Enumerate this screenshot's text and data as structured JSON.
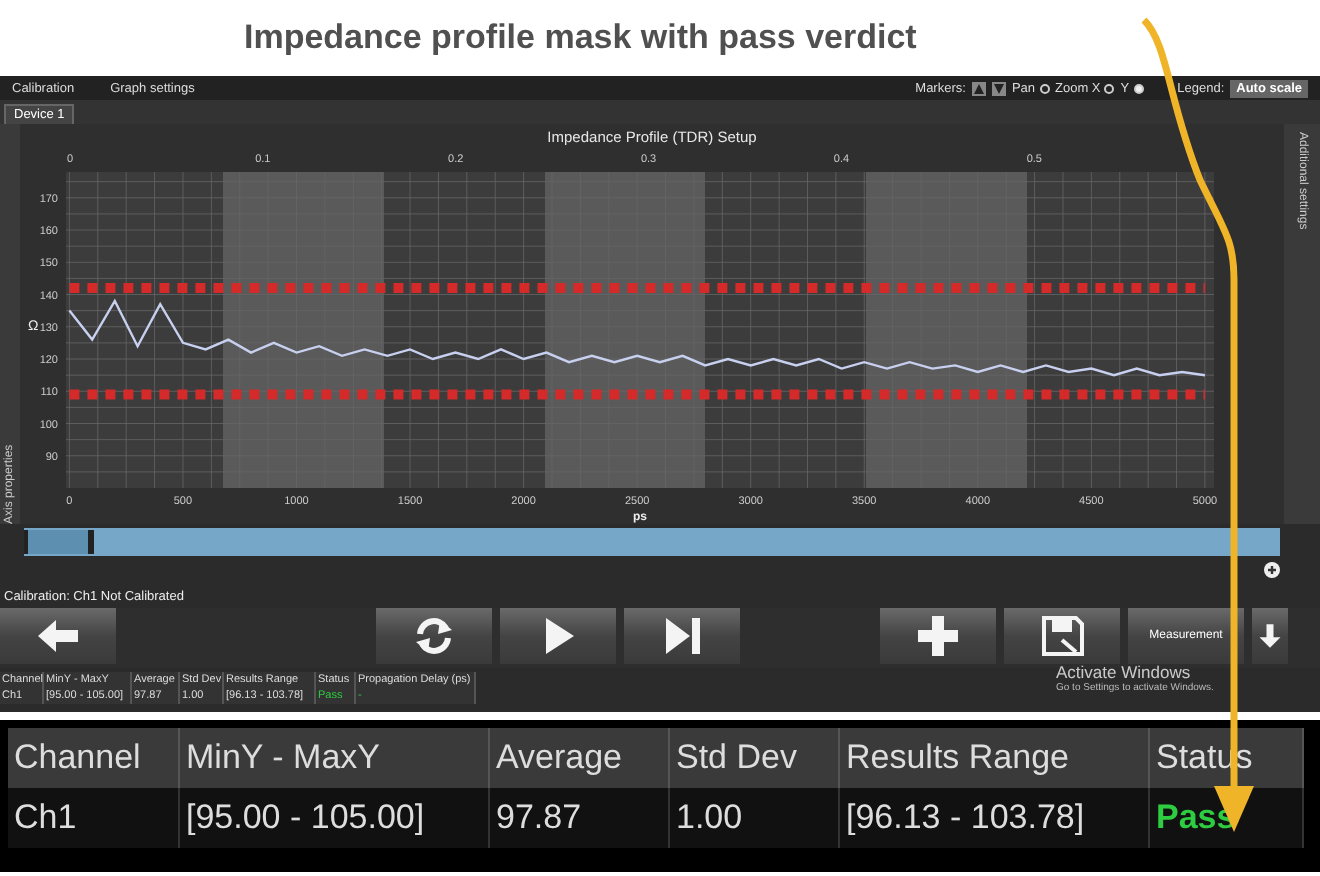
{
  "caption": "Impedance profile mask with pass verdict",
  "menu": [
    {
      "label": "Calibration"
    },
    {
      "label": "Graph settings"
    }
  ],
  "toolbar": {
    "markers_label": "Markers:",
    "modes": [
      {
        "label": "Pan",
        "selected": false
      },
      {
        "label": "Zoom X",
        "selected": false
      },
      {
        "label": "Y",
        "selected": true
      }
    ],
    "legend_label": "Legend:",
    "auto_scale": "Auto scale"
  },
  "tab": {
    "label": "Device 1",
    "selected": true
  },
  "side_panels": {
    "left": "Axis properties",
    "right": "Additional settings"
  },
  "chart": {
    "top_axis_ticks": [
      "0",
      "0.1",
      "0.2",
      "0.3",
      "0.4",
      "0.5"
    ],
    "chart_data": {
      "type": "line",
      "grid": true,
      "title": "Impedance Profile (TDR) Setup",
      "xlabel": "ps",
      "ylabel": "Ω",
      "xlim": [
        -15,
        5040
      ],
      "ylim": [
        80,
        178
      ],
      "xticks": [
        0,
        500,
        1000,
        1500,
        2000,
        2500,
        3000,
        3500,
        4000,
        4500,
        5000
      ],
      "yticks": [
        90,
        100,
        110,
        120,
        130,
        140,
        150,
        160,
        170
      ],
      "x": [
        0,
        100,
        200,
        300,
        400,
        500,
        600,
        700,
        800,
        900,
        1000,
        1100,
        1200,
        1300,
        1400,
        1500,
        1600,
        1700,
        1800,
        1900,
        2000,
        2100,
        2200,
        2300,
        2400,
        2500,
        2600,
        2700,
        2800,
        2900,
        3000,
        3100,
        3200,
        3300,
        3400,
        3500,
        3600,
        3700,
        3800,
        3900,
        4000,
        4100,
        4200,
        4300,
        4400,
        4500,
        4600,
        4700,
        4800,
        4900,
        5000
      ],
      "series": [
        {
          "color": "#c8d0f0",
          "line_style": "solid",
          "values": [
            135,
            126,
            138,
            124,
            137,
            125,
            123,
            126,
            122,
            125,
            122,
            124,
            121,
            123,
            121,
            123,
            120,
            122,
            120,
            123,
            120,
            122,
            119,
            121,
            119,
            121,
            119,
            121,
            118,
            120,
            118,
            120,
            118,
            120,
            117,
            119,
            117,
            119,
            117,
            118,
            116,
            118,
            116,
            118,
            116,
            117,
            115,
            117,
            115,
            116,
            115
          ]
        },
        {
          "color": "#d42a2a",
          "line_style": "dashed",
          "values": [
            142,
            142,
            142,
            142,
            142,
            142,
            142,
            142,
            142,
            142,
            142,
            142,
            142,
            142,
            142,
            142,
            142,
            142,
            142,
            142,
            142,
            142,
            142,
            142,
            142,
            142,
            142,
            142,
            142,
            142,
            142,
            142,
            142,
            142,
            142,
            142,
            142,
            142,
            142,
            142,
            142,
            142,
            142,
            142,
            142,
            142,
            142,
            142,
            142,
            142,
            142
          ]
        },
        {
          "color": "#d42a2a",
          "line_style": "dashed",
          "values": [
            109,
            109,
            109,
            109,
            109,
            109,
            109,
            109,
            109,
            109,
            109,
            109,
            109,
            109,
            109,
            109,
            109,
            109,
            109,
            109,
            109,
            109,
            109,
            109,
            109,
            109,
            109,
            109,
            109,
            109,
            109,
            109,
            109,
            109,
            109,
            109,
            109,
            109,
            109,
            109,
            109,
            109,
            109,
            109,
            109,
            109,
            109,
            109,
            109,
            109,
            109
          ]
        }
      ]
    }
  },
  "status_text": "Calibration: Ch1 Not Calibrated",
  "button_groups": [
    [
      {
        "kind": "back"
      }
    ],
    [
      {
        "kind": "refresh"
      },
      {
        "kind": "play"
      },
      {
        "kind": "step"
      }
    ],
    [
      {
        "kind": "add"
      },
      {
        "kind": "save"
      },
      {
        "kind": "measurement",
        "label": "Measurement"
      },
      {
        "kind": "down"
      }
    ]
  ],
  "activation_notice": {
    "title": "Activate Windows",
    "subtitle": "Go to Settings to activate Windows."
  },
  "results_table": {
    "columns": [
      "Channel",
      "MinY - MaxY",
      "Average",
      "Std Dev",
      "Results Range",
      "Status",
      "Propagation Delay (ps)"
    ],
    "rows": [
      {
        "cells": [
          "Ch1",
          "[95.00 - 105.00]",
          "97.87",
          "1.00",
          "[96.13 - 103.78]",
          "Pass",
          "-"
        ],
        "passed": true
      }
    ]
  },
  "zoomed_table": {
    "columns": [
      "Channel",
      "MinY - MaxY",
      "Average",
      "Std Dev",
      "Results Range",
      "Status"
    ],
    "rows": [
      {
        "cells": [
          "Ch1",
          "[95.00 - 105.00]",
          "97.87",
          "1.00",
          "[96.13 - 103.78]",
          "Pass"
        ],
        "passed": true
      }
    ]
  }
}
